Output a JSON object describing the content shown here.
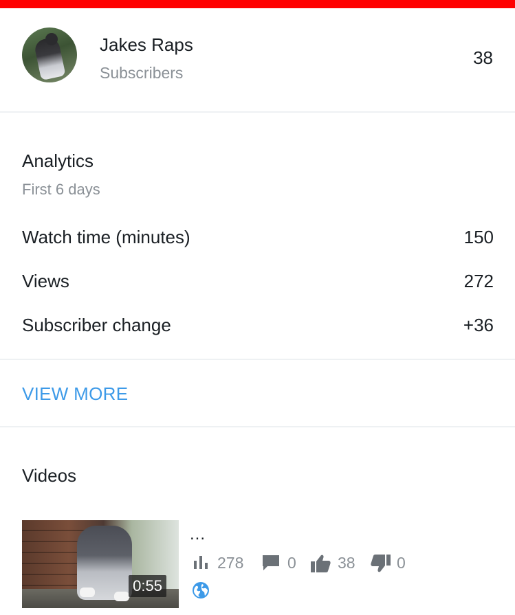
{
  "colors": {
    "top_bar": "#ff0000",
    "accent_link": "#3d9ae8",
    "primary_text": "#1a1f24",
    "secondary_text": "#8a9096"
  },
  "channel": {
    "name": "Jakes Raps",
    "subscribers_label": "Subscribers",
    "subscriber_count": "38",
    "avatar_icon": "channel-avatar"
  },
  "analytics": {
    "title": "Analytics",
    "period": "First 6 days",
    "metrics": [
      {
        "label": "Watch time (minutes)",
        "value": "150"
      },
      {
        "label": "Views",
        "value": "272"
      },
      {
        "label": "Subscriber change",
        "value": "+36"
      }
    ],
    "view_more_label": "VIEW MORE"
  },
  "videos": {
    "title": "Videos",
    "items": [
      {
        "title": "...",
        "duration": "0:55",
        "views": "278",
        "comments": "0",
        "likes": "38",
        "dislikes": "0",
        "visibility_icon": "globe-icon"
      }
    ]
  }
}
